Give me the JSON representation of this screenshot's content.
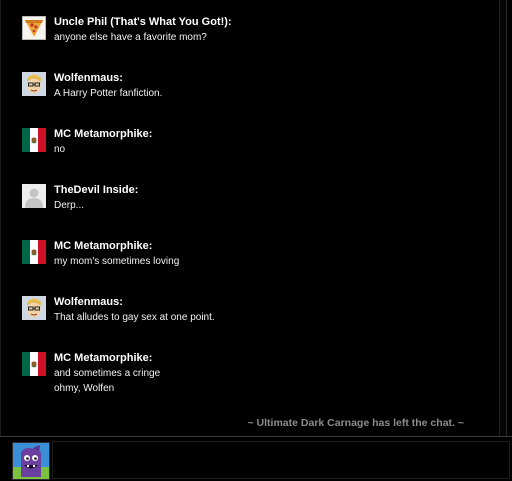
{
  "messages": [
    {
      "user": "Uncle Phil (That's What You Got!):",
      "avatar": "pizza-slice-avatar",
      "lines": [
        "anyone else have a favorite mom?"
      ]
    },
    {
      "user": "Wolfenmaus:",
      "avatar": "cartoon-face-avatar",
      "lines": [
        "A Harry Potter fanfiction."
      ]
    },
    {
      "user": "MC Metamorphike:",
      "avatar": "mexico-flag-avatar",
      "lines": [
        "no"
      ]
    },
    {
      "user": "TheDevil Inside:",
      "avatar": "default-user-avatar",
      "lines": [
        "Derp..."
      ]
    },
    {
      "user": "MC Metamorphike:",
      "avatar": "mexico-flag-avatar",
      "lines": [
        "my mom's sometimes loving"
      ]
    },
    {
      "user": "Wolfenmaus:",
      "avatar": "cartoon-face-avatar",
      "lines": [
        "That alludes to gay sex at one point."
      ]
    },
    {
      "user": "MC Metamorphike:",
      "avatar": "mexico-flag-avatar",
      "lines": [
        "and sometimes a cringe",
        "ohmy, Wolfen"
      ]
    }
  ],
  "system_notice": "~ Ultimate Dark Carnage has left the chat. ~",
  "input": {
    "value": "",
    "self_avatar": "purple-monster-avatar"
  },
  "colors": {
    "background": "#000000",
    "username": "#ffffff",
    "message_text": "#f2f2f2",
    "notice": "#8c8c8c",
    "flag_green": "#006847",
    "flag_white": "#ffffff",
    "flag_red": "#ce1126"
  }
}
